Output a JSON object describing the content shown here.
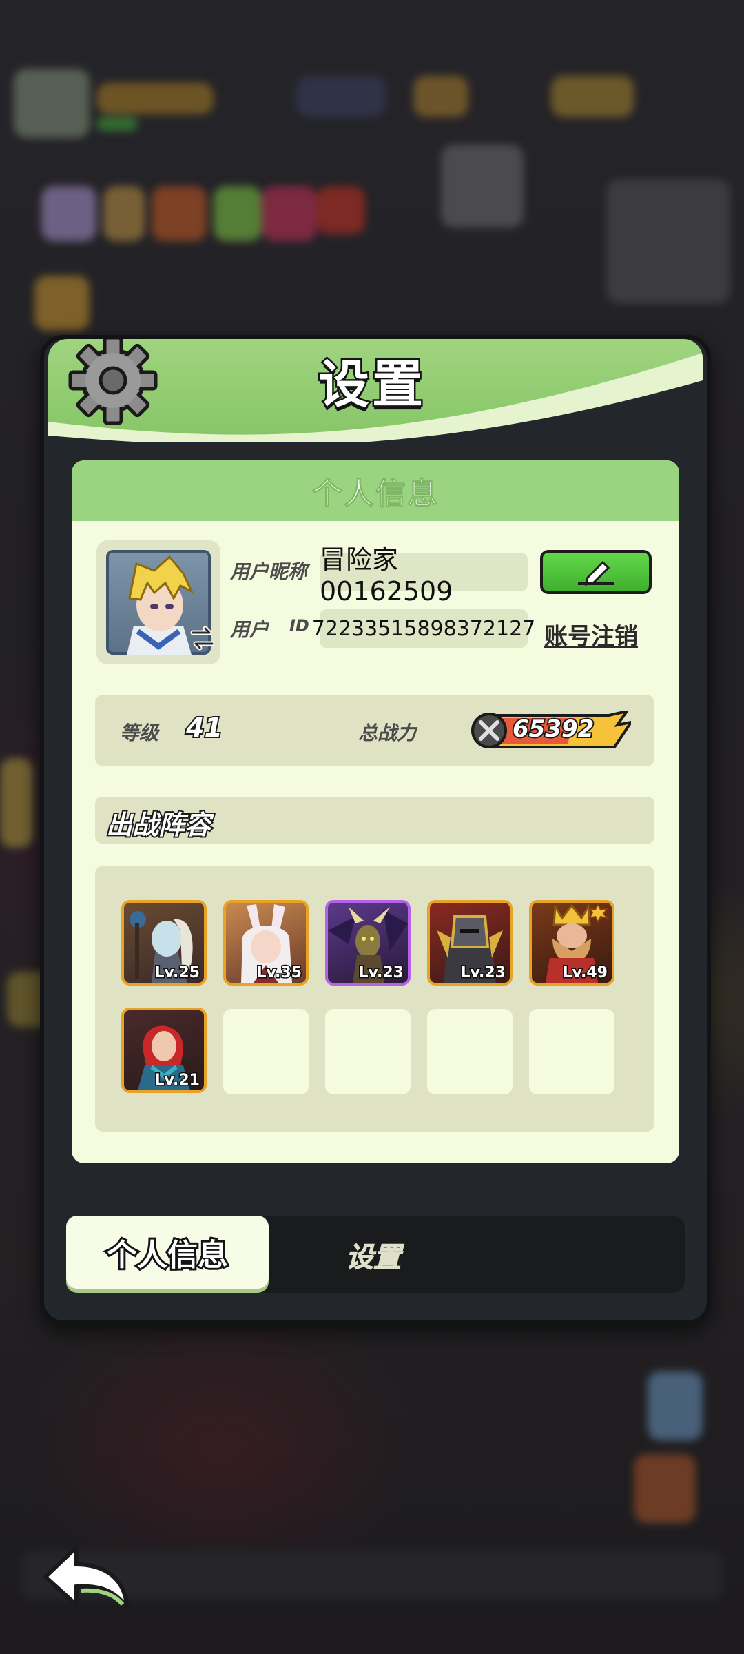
{
  "dialog": {
    "title": "设置"
  },
  "personal_panel": {
    "header": "个人信息",
    "nickname_label": "用户昵称",
    "nickname_value": "冒险家00162509",
    "id_label": "用户",
    "id_label_suffix": "ID",
    "id_value": "72233515898372127",
    "account_cancel_link": "账号注销",
    "level_label": "等级",
    "level_value": "41",
    "power_label": "总战力",
    "power_value": "65392"
  },
  "lineup": {
    "title": "出战阵容",
    "heroes": [
      {
        "level": "Lv.25",
        "rarity": "legendary",
        "icon": "ghost-mage-portrait"
      },
      {
        "level": "Lv.35",
        "rarity": "legendary",
        "icon": "bunny-girl-portrait"
      },
      {
        "level": "Lv.23",
        "rarity": "epic",
        "icon": "horned-demon-portrait"
      },
      {
        "level": "Lv.23",
        "rarity": "legendary",
        "icon": "armored-knight-portrait"
      },
      {
        "level": "Lv.49",
        "rarity": "legendary",
        "icon": "dwarf-king-portrait"
      },
      {
        "level": "Lv.21",
        "rarity": "legendary",
        "icon": "red-hair-warrior-portrait"
      }
    ],
    "empty_slots": 4
  },
  "tabs": [
    {
      "label": "个人信息",
      "active": true
    },
    {
      "label": "设置",
      "active": false
    }
  ],
  "colors": {
    "header_green": "#9fd47f",
    "panel_bg": "#f4fbdf",
    "edit_button": "#4fc33a",
    "legendary_border": "#e8a226",
    "epic_border": "#b562e8"
  }
}
